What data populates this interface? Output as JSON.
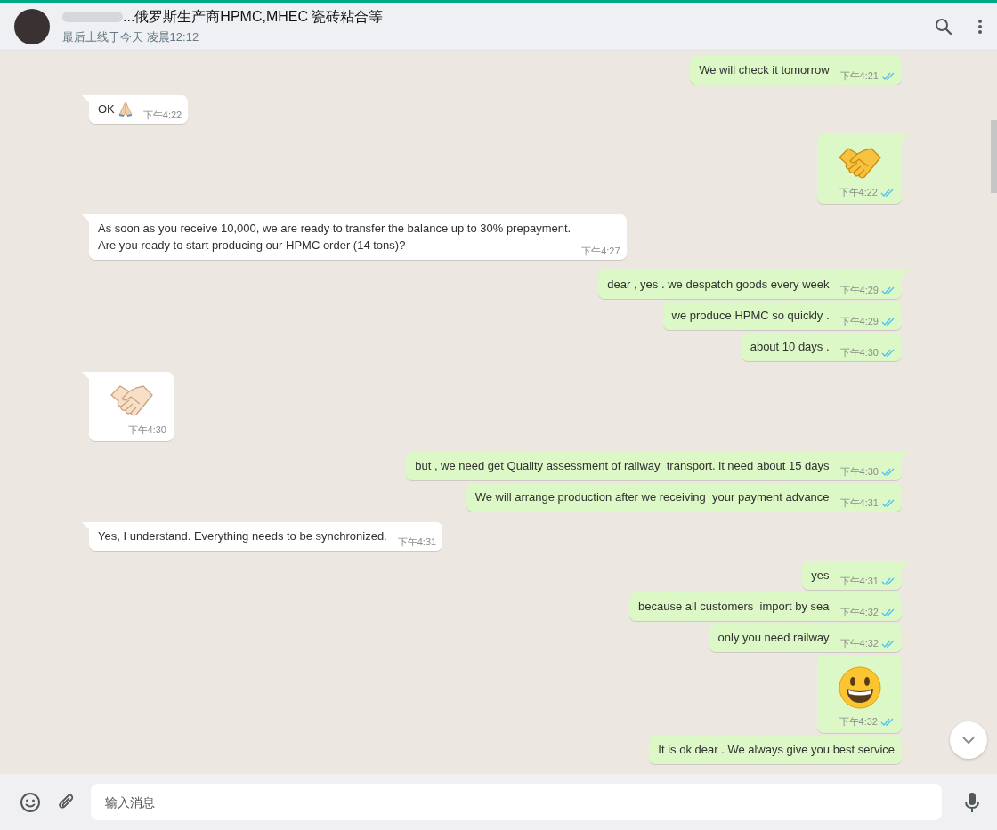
{
  "header": {
    "name": "...俄罗斯生产商HPMC,MHEC 瓷砖粘合等",
    "status": "最后上线于今天 凌晨12:12"
  },
  "messages": [
    {
      "outgoing": true,
      "kind": "text",
      "text": "We will check it tomorrow",
      "time": "下午4:21",
      "read": true
    },
    {
      "outgoing": false,
      "kind": "text-praying",
      "text": "OK",
      "time": "下午4:22"
    },
    {
      "outgoing": true,
      "kind": "handshake",
      "time": "下午4:22",
      "read": true
    },
    {
      "outgoing": false,
      "kind": "text",
      "text": "As soon as you receive 10,000, we are ready to transfer the balance up to 30% prepayment.\nAre you ready to start producing our HPMC order (14 tons)?",
      "time": "下午4:27"
    },
    {
      "outgoing": true,
      "kind": "text",
      "text": "dear , yes . we despatch goods every week",
      "time": "下午4:29",
      "read": true
    },
    {
      "outgoing": true,
      "kind": "text",
      "text": "we produce HPMC so quickly .",
      "time": "下午4:29",
      "read": true
    },
    {
      "outgoing": true,
      "kind": "text",
      "text": "about 10 days .",
      "time": "下午4:30",
      "read": true
    },
    {
      "outgoing": false,
      "kind": "handshake",
      "time": "下午4:30"
    },
    {
      "outgoing": true,
      "kind": "text",
      "text": "but , we need get Quality assessment of railway  transport. it need about 15 days",
      "time": "下午4:30",
      "read": true
    },
    {
      "outgoing": true,
      "kind": "text",
      "text": "We will arrange production after we receiving  your payment advance",
      "time": "下午4:31",
      "read": true
    },
    {
      "outgoing": false,
      "kind": "text",
      "text": "Yes, I understand. Everything needs to be synchronized.",
      "time": "下午4:31"
    },
    {
      "outgoing": true,
      "kind": "text",
      "text": "yes",
      "time": "下午4:31",
      "read": true
    },
    {
      "outgoing": true,
      "kind": "text",
      "text": "because all customers  import by sea",
      "time": "下午4:32",
      "read": true
    },
    {
      "outgoing": true,
      "kind": "text",
      "text": "only you need railway",
      "time": "下午4:32",
      "read": true
    },
    {
      "outgoing": true,
      "kind": "smiley",
      "time": "下午4:32",
      "read": true
    },
    {
      "outgoing": true,
      "kind": "text",
      "text": "It is ok dear . We always give you best service"
    }
  ],
  "composer": {
    "placeholder": "输入消息"
  }
}
